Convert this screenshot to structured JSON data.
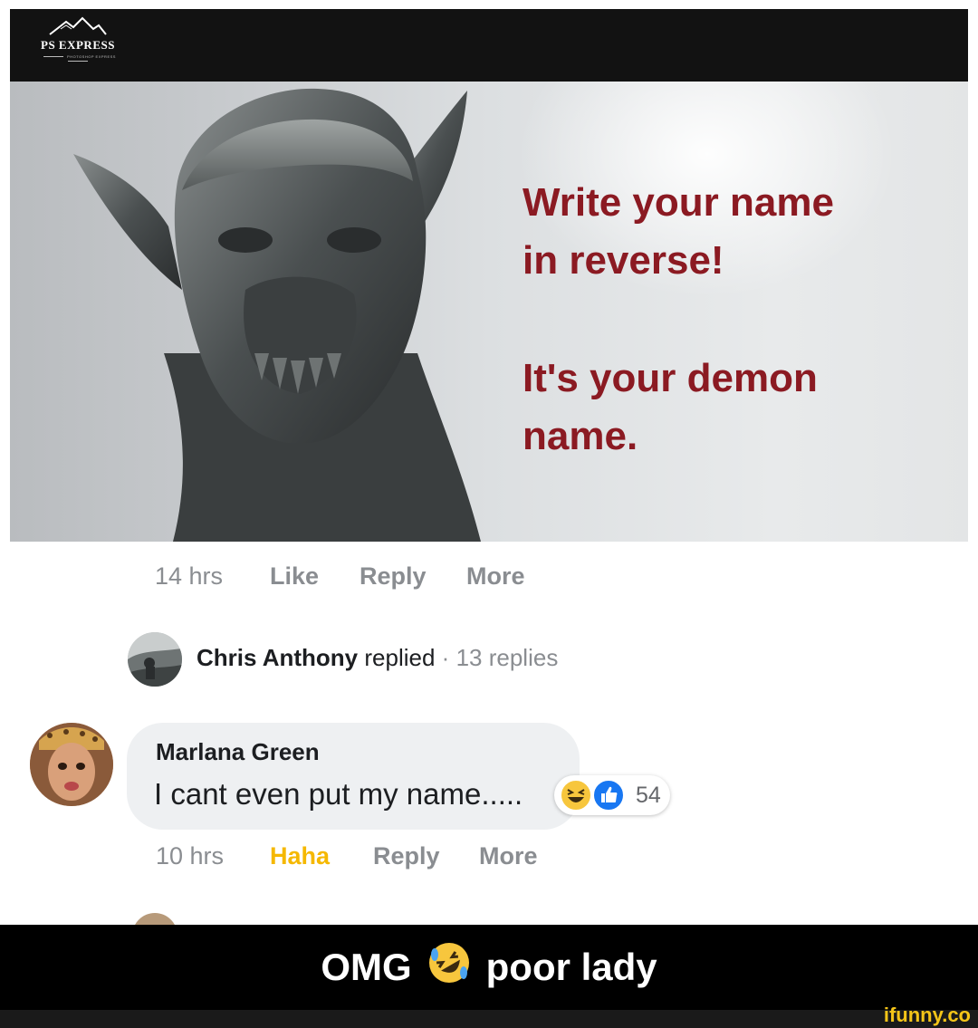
{
  "brand": {
    "logo_name": "PS EXPRESS",
    "logo_tagline": "PHOTOSHOP EXPRESS"
  },
  "meme": {
    "line1": "Write your name",
    "line2": "in reverse!",
    "line3": "It's your demon",
    "line4": "name.",
    "text_color": "#8b1a22"
  },
  "post_actions": {
    "time": "14 hrs",
    "like": "Like",
    "reply": "Reply",
    "more": "More"
  },
  "reply_summary": {
    "name": "Chris Anthony",
    "action": "replied",
    "separator": "·",
    "count": "13 replies"
  },
  "comment": {
    "author": "Marlana Green",
    "text": "I cant even put my name.....",
    "reaction_icons": [
      "haha-icon",
      "like-icon"
    ],
    "reaction_count": "54"
  },
  "comment_actions": {
    "time": "10 hrs",
    "reaction": "Haha",
    "reaction_color": "#f5b800",
    "reply": "Reply",
    "more": "More"
  },
  "caption": {
    "before": "OMG",
    "emoji": "rolling-on-floor-laughing-icon",
    "after": "poor lady"
  },
  "watermark": "ifunny.co"
}
